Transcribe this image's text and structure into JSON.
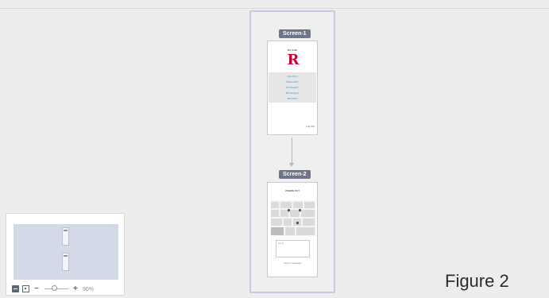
{
  "screens": [
    {
      "tag": "Screen-1",
      "title": "RU Chat!",
      "logo_letter": "R",
      "menu_items": [
        "How RU?",
        "Where RU?",
        "RU Ready?",
        "RU Hungry?",
        "Who RU?"
      ],
      "footer": "Log Out"
    },
    {
      "tag": "Screen-2",
      "title": "WHERE RU?",
      "message_placeholder": "Say hi...",
      "send_label": "Send a message"
    }
  ],
  "minimap": {
    "zoom_label": "90%",
    "zoom_percent": 90,
    "minus_glyph": "−",
    "plus_glyph": "+"
  },
  "figure_label": "Figure 2",
  "colors": {
    "background": "#ededed",
    "column_border": "#c8c9e3",
    "tag_bg": "#6f7486",
    "logo": "#cc0033",
    "link": "#2f8fd4"
  }
}
